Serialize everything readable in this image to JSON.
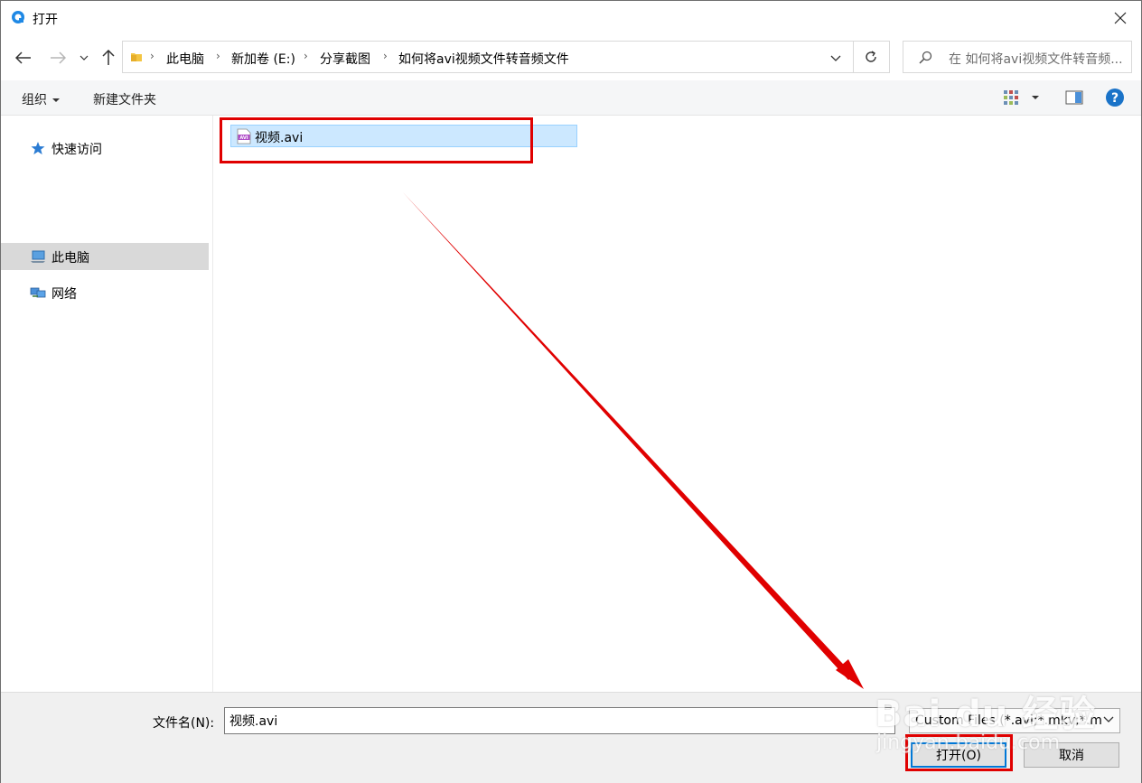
{
  "window": {
    "title": "打开"
  },
  "address": {
    "crumbs": [
      "此电脑",
      "新加卷 (E:)",
      "分享截图",
      "如何将avi视频文件转音频文件"
    ]
  },
  "search": {
    "placeholder": "在 如何将avi视频文件转音频..."
  },
  "toolbar": {
    "organize": "组织",
    "new_folder": "新建文件夹"
  },
  "nav": {
    "items": [
      {
        "label": "快速访问",
        "icon": "star-icon"
      },
      {
        "label": "此电脑",
        "icon": "computer-icon",
        "selected": true
      },
      {
        "label": "网络",
        "icon": "network-icon"
      }
    ]
  },
  "files": [
    {
      "name": "视频.avi",
      "icon": "avi-file-icon",
      "selected": true
    }
  ],
  "bottom": {
    "filename_label": "文件名(N):",
    "filename_value": "视频.avi",
    "filetype_value": "Custom Files (*.avi;*.mkv;*.m",
    "open_label": "打开(O)",
    "cancel_label": "取消"
  },
  "watermark": {
    "main": "Bai du 经验",
    "sub": "jingyan.baidu.com"
  },
  "colors": {
    "annotation": "#e00000",
    "selection": "#cce8ff",
    "accent": "#0078d7"
  }
}
